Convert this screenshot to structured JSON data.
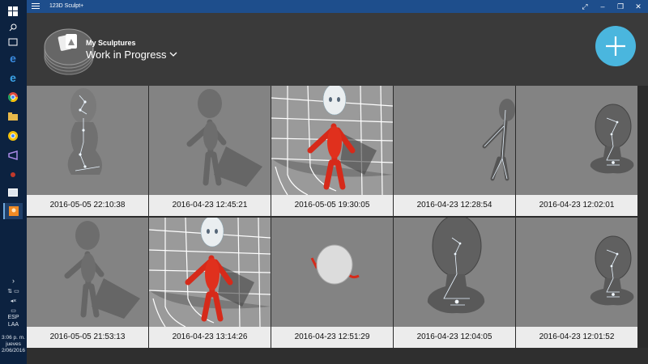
{
  "window": {
    "title": "123D Sculpt+"
  },
  "header": {
    "subtitle": "My Sculptures",
    "folder": "Work in Progress"
  },
  "sculptures": [
    {
      "date": "2016-05-05 22:10:38",
      "kind": "skeleton-head"
    },
    {
      "date": "2016-04-23 12:45:21",
      "kind": "gray-figure"
    },
    {
      "date": "2016-05-05 19:30:05",
      "kind": "red-figure"
    },
    {
      "date": "2016-04-23 12:28:54",
      "kind": "skeleton-figure"
    },
    {
      "date": "2016-04-23 12:02:01",
      "kind": "bust"
    },
    {
      "date": "2016-05-05 21:53:13",
      "kind": "gray-figure"
    },
    {
      "date": "2016-04-23 13:14:26",
      "kind": "red-figure"
    },
    {
      "date": "2016-04-23 12:51:29",
      "kind": "blob"
    },
    {
      "date": "2016-04-23 12:04:05",
      "kind": "bust-large"
    },
    {
      "date": "2016-04-23 12:01:52",
      "kind": "bust"
    }
  ],
  "taskbar": {
    "lang": "ESP",
    "region": "LAA",
    "time": "3:06 p. m.",
    "day": "jueves",
    "date": "2/06/2016"
  }
}
